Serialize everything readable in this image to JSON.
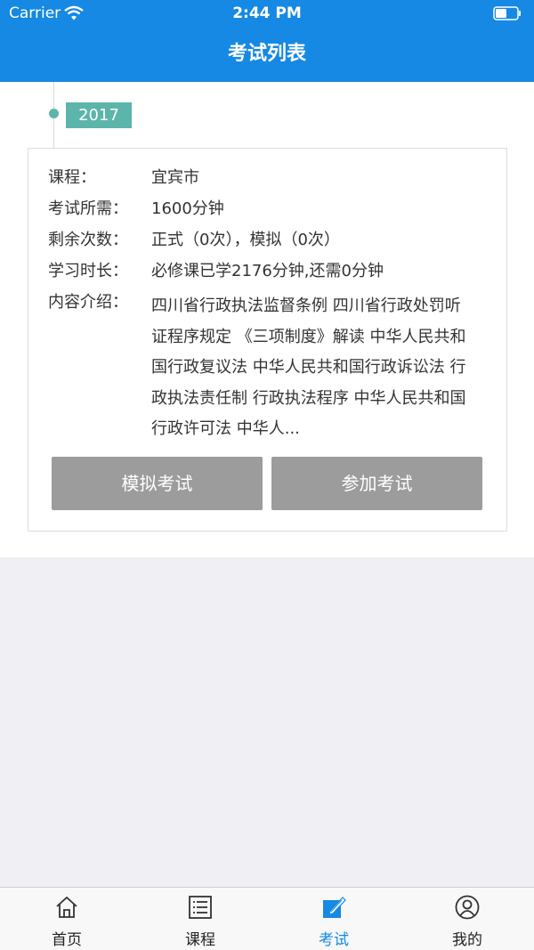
{
  "status_bar": {
    "carrier": "Carrier",
    "time": "2:44 PM"
  },
  "nav": {
    "title": "考试列表"
  },
  "timeline": {
    "year": "2017"
  },
  "card": {
    "course_label": "课程：",
    "course_value": "宜宾市",
    "duration_label": "考试所需：",
    "duration_value": "1600分钟",
    "remaining_label": "剩余次数：",
    "remaining_value": "正式（0次），模拟（0次）",
    "study_label": "学习时长：",
    "study_value": "必修课已学2176分钟,还需0分钟",
    "intro_label": "内容介绍：",
    "intro_value": "四川省行政执法监督条例 四川省行政处罚听证程序规定 《三项制度》解读 中华人民共和国行政复议法 中华人民共和国行政诉讼法 行政执法责任制 行政执法程序 中华人民共和国行政许可法 中华人...",
    "mock_button": "模拟考试",
    "join_button": "参加考试"
  },
  "tabs": [
    {
      "label": "首页",
      "icon": "home-icon",
      "active": false
    },
    {
      "label": "课程",
      "icon": "list-icon",
      "active": false
    },
    {
      "label": "考试",
      "icon": "edit-icon",
      "active": true
    },
    {
      "label": "我的",
      "icon": "user-icon",
      "active": false
    }
  ],
  "colors": {
    "primary": "#1589e3",
    "accent": "#5bb5aa",
    "button": "#9c9c9c"
  }
}
